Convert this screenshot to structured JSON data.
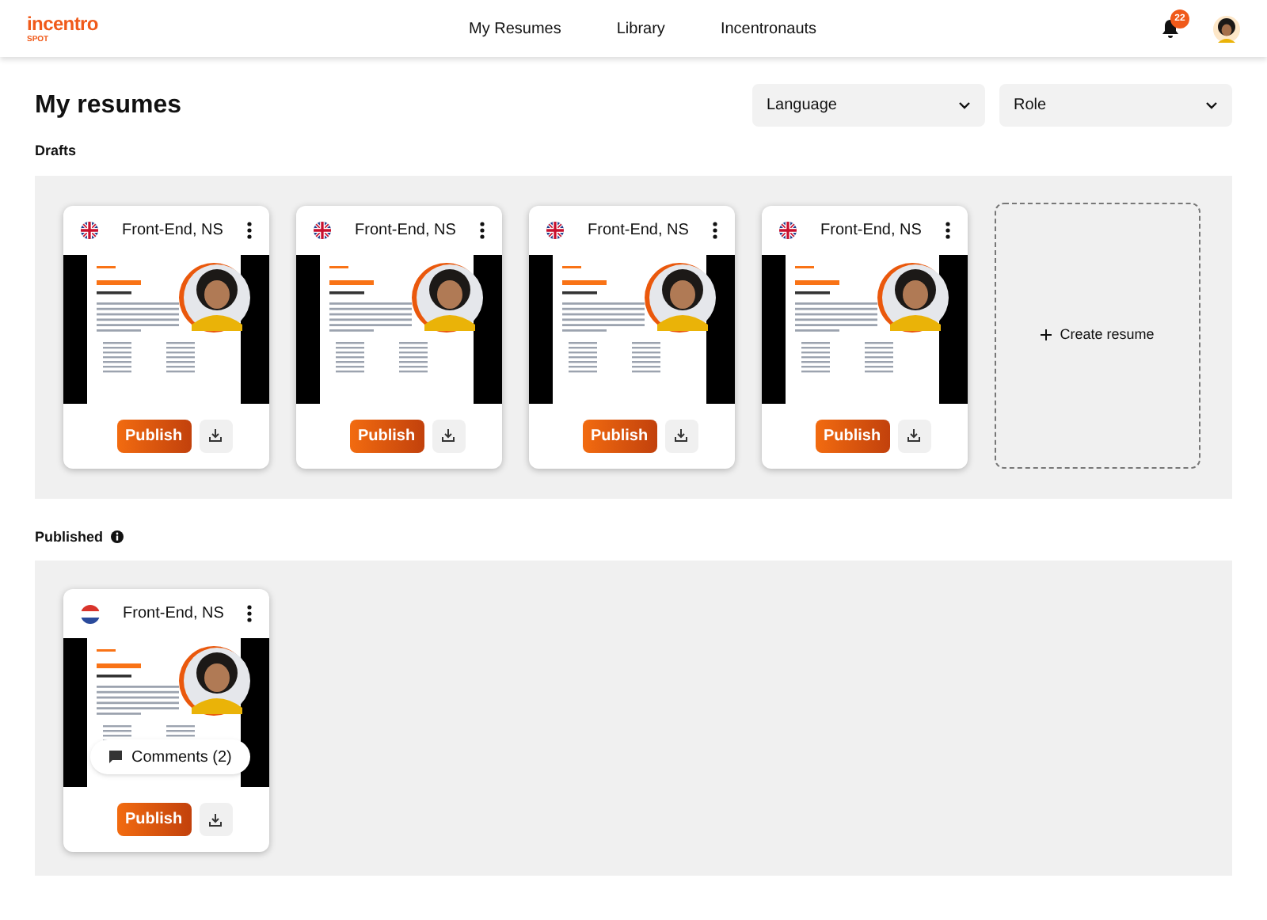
{
  "header": {
    "logo": "incentro",
    "logo_sub": "SPOT",
    "nav": [
      "My Resumes",
      "Library",
      "Incentronauts"
    ],
    "notification_count": "22"
  },
  "page_title": "My resumes",
  "filters": [
    {
      "placeholder": "Language"
    },
    {
      "placeholder": "Role"
    }
  ],
  "drafts": {
    "label": "Drafts",
    "create_label": "Create resume",
    "cards": [
      {
        "kind": "uk",
        "title": "Front-End, NS",
        "publish": "Publish"
      },
      {
        "kind": "uk",
        "title": "Front-End, NS",
        "publish": "Publish"
      },
      {
        "kind": "uk",
        "title": "Front-End, NS",
        "publish": "Publish"
      },
      {
        "kind": "uk",
        "title": "Front-End, NS",
        "publish": "Publish"
      }
    ]
  },
  "published": {
    "label": "Published",
    "cards": [
      {
        "kind": "nl",
        "title": "Front-End, NS",
        "publish": "Publish",
        "comments": "Comments (2)"
      }
    ]
  }
}
